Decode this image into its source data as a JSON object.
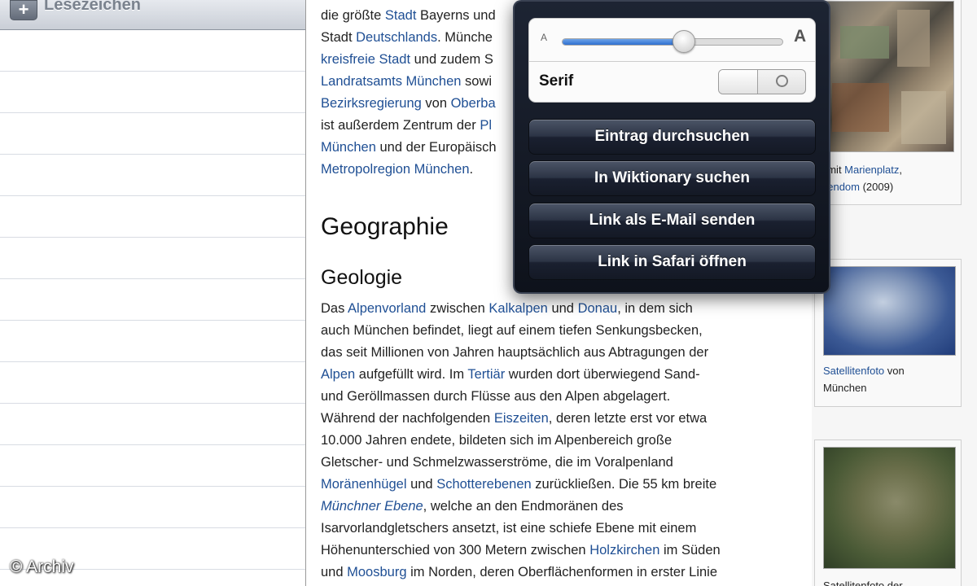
{
  "sidebar": {
    "title": "Lesezeichen",
    "add_button_label": "+"
  },
  "article": {
    "top_lines": [
      [
        {
          "t": "die größte "
        },
        {
          "t": "Stadt",
          "link": true
        },
        {
          "t": " Bayerns und"
        }
      ],
      [
        {
          "t": "Stadt "
        },
        {
          "t": "Deutschlands",
          "link": true
        },
        {
          "t": ". Münche"
        }
      ],
      [
        {
          "t": "kreisfreie Stadt",
          "link": true
        },
        {
          "t": " und zudem S"
        }
      ],
      [
        {
          "t": "Landratsamts München",
          "link": true
        },
        {
          "t": " sowi"
        }
      ],
      [
        {
          "t": "Bezirksregierung",
          "link": true
        },
        {
          "t": " von "
        },
        {
          "t": "Oberba",
          "link": true
        }
      ],
      [
        {
          "t": "ist außerdem Zentrum der "
        },
        {
          "t": "Pl",
          "link": true
        }
      ],
      [
        {
          "t": "München",
          "link": true
        },
        {
          "t": " und der Europäisch"
        }
      ],
      [
        {
          "t": "Metropolregion München",
          "link": true
        },
        {
          "t": "."
        }
      ]
    ],
    "heading": "Geographie",
    "subheading": "Geologie",
    "body_lines": [
      [
        {
          "t": "Das "
        },
        {
          "t": "Alpenvorland",
          "link": true
        },
        {
          "t": " zwischen "
        },
        {
          "t": "Kalkalpen",
          "link": true
        },
        {
          "t": " und "
        },
        {
          "t": "Donau",
          "link": true
        },
        {
          "t": ", in dem sich"
        }
      ],
      [
        {
          "t": "auch München befindet, liegt auf einem tiefen Senkungsbecken,"
        }
      ],
      [
        {
          "t": "das seit Millionen von Jahren hauptsächlich aus Abtragungen der"
        }
      ],
      [
        {
          "t": "Alpen",
          "link": true
        },
        {
          "t": " aufgefüllt wird. Im "
        },
        {
          "t": "Tertiär",
          "link": true
        },
        {
          "t": " wurden dort überwiegend Sand-"
        }
      ],
      [
        {
          "t": "und Geröllmassen durch Flüsse aus den Alpen abgelagert."
        }
      ],
      [
        {
          "t": "Während der nachfolgenden "
        },
        {
          "t": "Eiszeiten",
          "link": true
        },
        {
          "t": ", deren letzte erst vor etwa"
        }
      ],
      [
        {
          "t": "10.000 Jahren endete, bildeten sich im Alpenbereich große"
        }
      ],
      [
        {
          "t": "Gletscher- und Schmelzwasserströme, die im Voralpenland"
        }
      ],
      [
        {
          "t": "Moränenhügel",
          "link": true
        },
        {
          "t": " und "
        },
        {
          "t": "Schotterebenen",
          "link": true
        },
        {
          "t": " zurückließen. Die 55 km breite"
        }
      ],
      [
        {
          "t": "Münchner Ebene",
          "link": true,
          "italic": true
        },
        {
          "t": ", welche an den Endmoränen des"
        }
      ],
      [
        {
          "t": "Isarvorlandgletschers ansetzt, ist eine schiefe Ebene mit einem"
        }
      ],
      [
        {
          "t": "Höhenunterschied von 300 Metern zwischen "
        },
        {
          "t": "Holzkirchen",
          "link": true
        },
        {
          "t": " im Süden"
        }
      ],
      [
        {
          "t": "und "
        },
        {
          "t": "Moosburg",
          "link": true
        },
        {
          "t": " im Norden, deren Oberflächenformen in erster Linie"
        }
      ]
    ]
  },
  "images": {
    "card1": {
      "caption_lines": [
        [
          {
            "t": "t mit "
          },
          {
            "t": "Marienplatz",
            "link": true
          },
          {
            "t": ","
          }
        ],
        [
          {
            "t": "uendom",
            "link": true
          },
          {
            "t": " (2009)"
          }
        ]
      ]
    },
    "card2": {
      "caption_lines": [
        [
          {
            "t": "Satellitenfoto",
            "link": true
          },
          {
            "t": " von"
          }
        ],
        [
          {
            "t": "München"
          }
        ]
      ]
    },
    "card3": {
      "caption_lines": [
        [
          {
            "t": "Satellitenfoto der"
          }
        ]
      ]
    }
  },
  "popover": {
    "font_small_label": "A",
    "font_large_label": "A",
    "font_size_level": 0.55,
    "serif_label": "Serif",
    "serif_enabled": false,
    "buttons": [
      "Eintrag durchsuchen",
      "In Wiktionary suchen",
      "Link als E-Mail senden",
      "Link in Safari öffnen"
    ]
  },
  "watermark": "© Archiv",
  "colors": {
    "link": "#1f4f94",
    "popover_bg": "#141925",
    "slider_fill": "#2f6fd0"
  }
}
